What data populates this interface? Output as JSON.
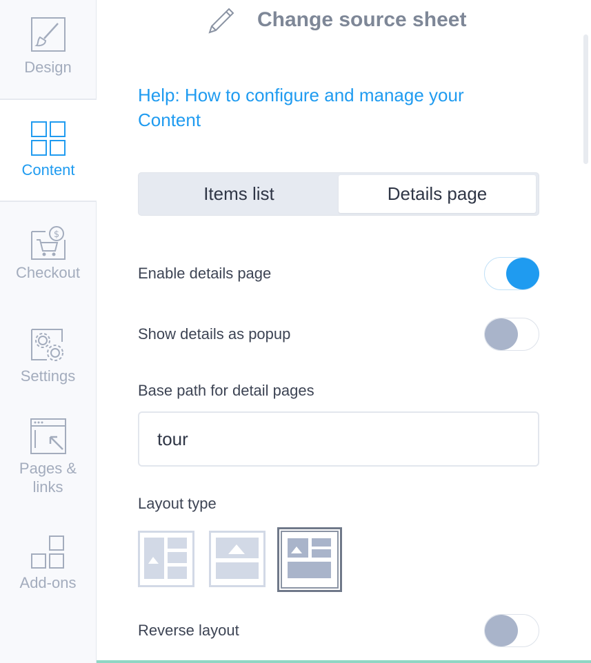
{
  "sidebar": {
    "items": [
      {
        "label": "Design",
        "icon": "brush-icon",
        "active": false
      },
      {
        "label": "Content",
        "icon": "grid-icon",
        "active": true
      },
      {
        "label": "Checkout",
        "icon": "cart-icon",
        "active": false
      },
      {
        "label": "Settings",
        "icon": "gears-icon",
        "active": false
      },
      {
        "label": "Pages & links",
        "icon": "link-arrow-icon",
        "active": false
      },
      {
        "label": "Add-ons",
        "icon": "addons-icon",
        "active": false
      }
    ]
  },
  "header": {
    "icon": "pencil-icon",
    "title": "Change source sheet"
  },
  "help_link": "Help: How to configure and manage your Content",
  "tabs": [
    {
      "label": "Items list",
      "selected": false
    },
    {
      "label": "Details page",
      "selected": true
    }
  ],
  "settings": {
    "enable_details": {
      "label": "Enable details page",
      "on": true
    },
    "show_popup": {
      "label": "Show details as popup",
      "on": false
    },
    "base_path": {
      "label": "Base path for detail pages",
      "value": "tour"
    },
    "layout_type": {
      "label": "Layout type",
      "options": [
        "side-by-side",
        "image-top",
        "image-left-grid"
      ],
      "selected": "image-left-grid"
    },
    "reverse_layout": {
      "label": "Reverse layout",
      "on": false
    }
  },
  "colors": {
    "accent": "#1f9bf0",
    "muted": "#a3acbd",
    "toggle_off": "#a9b4ca"
  }
}
